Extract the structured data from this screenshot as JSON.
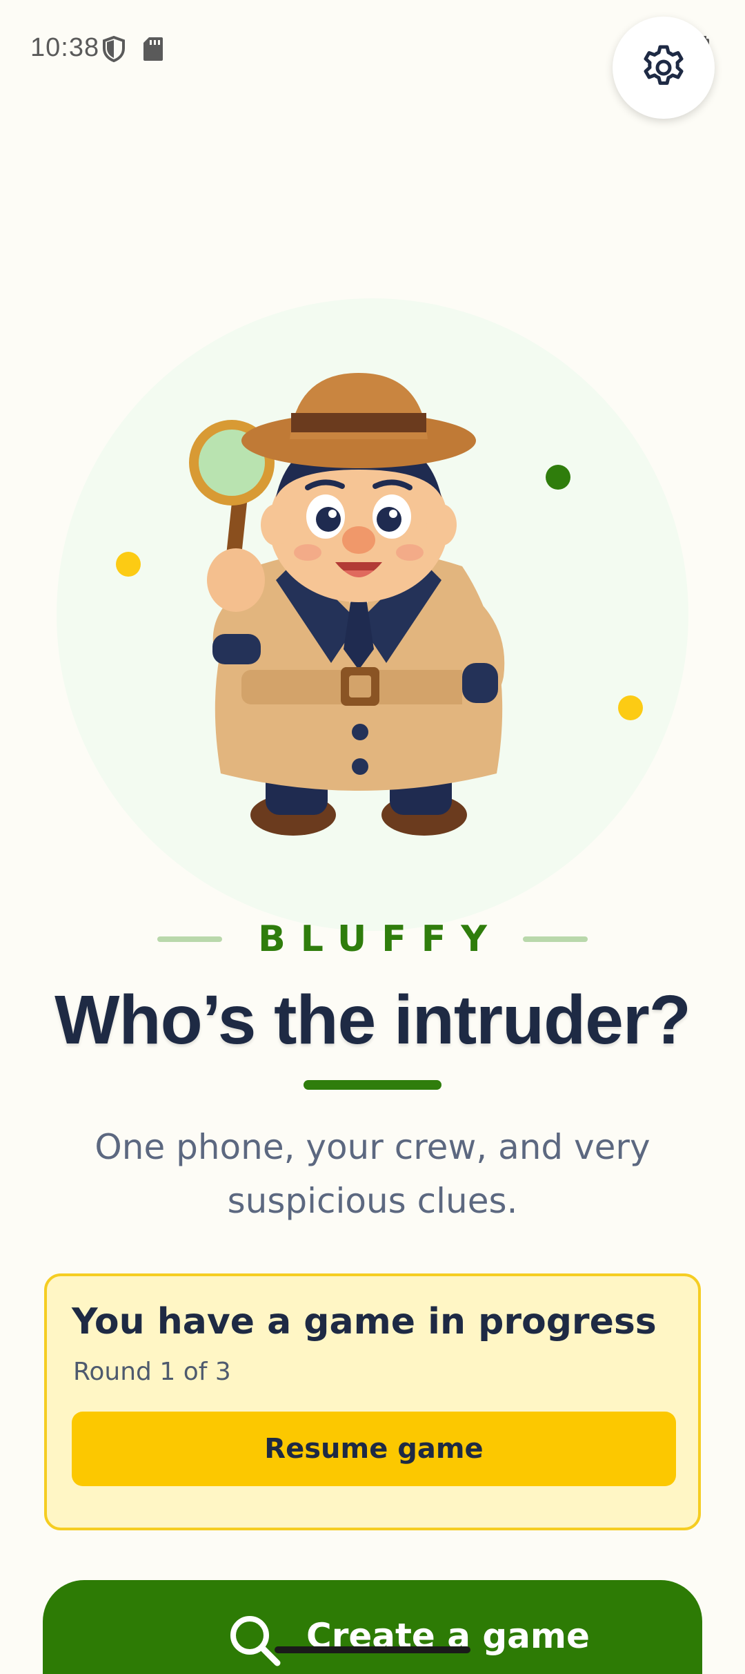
{
  "status_bar": {
    "time": "10:38"
  },
  "header": {
    "settings_icon": "gear-icon"
  },
  "hero": {
    "illustration": "detective-mascot",
    "brand_name": "BLUFFY",
    "headline": "Who’s the intruder?",
    "tagline": "One phone, your crew, and very suspicious clues."
  },
  "progress_card": {
    "title": "You have a game in progress",
    "round": "Round 1 of 3",
    "resume_label": "Resume game"
  },
  "create_game": {
    "label": "Create a game",
    "icon": "search-icon"
  },
  "colors": {
    "background": "#fdfcf6",
    "brand_green": "#2f7d0c",
    "accent_yellow": "#fcc800",
    "card_bg": "#fff6c5",
    "text_dark": "#1e2a44"
  }
}
